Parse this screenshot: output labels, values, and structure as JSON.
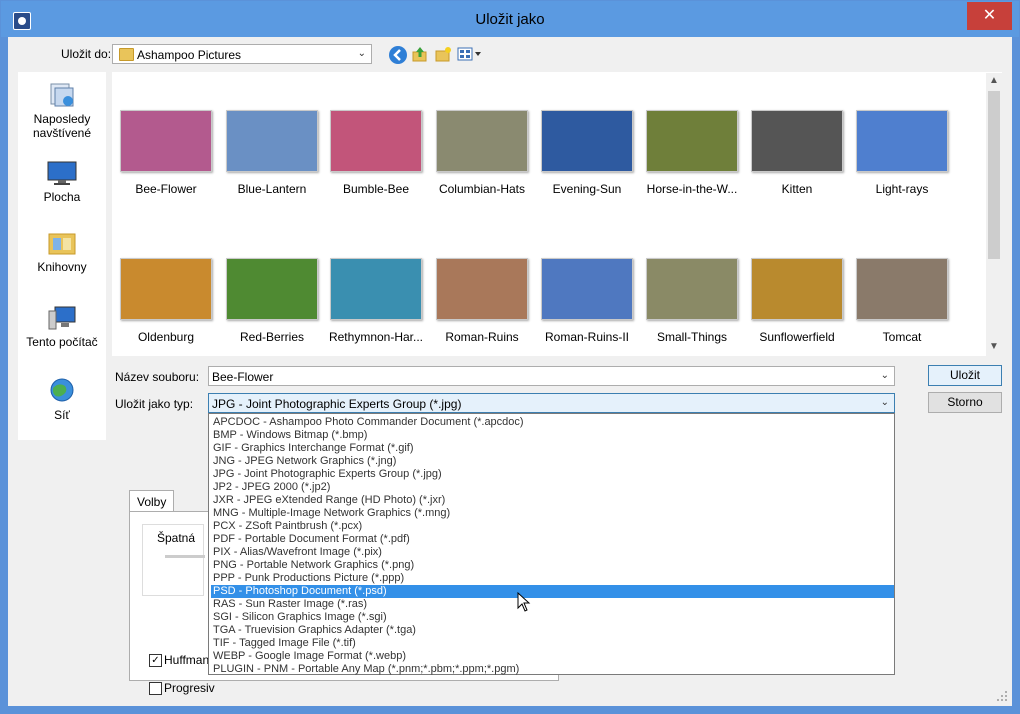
{
  "window": {
    "title": "Uložit jako",
    "close": "✕"
  },
  "save_in": {
    "label": "Uložit do:",
    "value": "Ashampoo Pictures"
  },
  "places": [
    {
      "label": "Naposledy navštívené",
      "icon": "recent-places-icon"
    },
    {
      "label": "Plocha",
      "icon": "desktop-icon"
    },
    {
      "label": "Knihovny",
      "icon": "libraries-icon"
    },
    {
      "label": "Tento počítač",
      "icon": "computer-icon"
    },
    {
      "label": "Síť",
      "icon": "network-icon"
    }
  ],
  "thumbnails": [
    {
      "name": "Bee-Flower",
      "color": "#b35a8e"
    },
    {
      "name": "Blue-Lantern",
      "color": "#6a90c4"
    },
    {
      "name": "Bumble-Bee",
      "color": "#c2557a"
    },
    {
      "name": "Columbian-Hats",
      "color": "#8a8a70"
    },
    {
      "name": "Evening-Sun",
      "color": "#2e5aa0"
    },
    {
      "name": "Horse-in-the-W...",
      "color": "#6f7f3a"
    },
    {
      "name": "Kitten",
      "color": "#555555"
    },
    {
      "name": "Light-rays",
      "color": "#4f7fcf"
    },
    {
      "name": "Oldenburg",
      "color": "#c98a2e"
    },
    {
      "name": "Red-Berries",
      "color": "#4f8a32"
    },
    {
      "name": "Rethymnon-Har...",
      "color": "#3a8fb0"
    },
    {
      "name": "Roman-Ruins",
      "color": "#a9785a"
    },
    {
      "name": "Roman-Ruins-II",
      "color": "#4f78c0"
    },
    {
      "name": "Small-Things",
      "color": "#8a8a66"
    },
    {
      "name": "Sunflowerfield",
      "color": "#b98a2e"
    },
    {
      "name": "Tomcat",
      "color": "#8a7a6a"
    }
  ],
  "filename": {
    "label": "Název souboru:",
    "value": "Bee-Flower"
  },
  "filetype": {
    "label": "Uložit jako typ:",
    "value": "JPG - Joint Photographic Experts Group (*.jpg)"
  },
  "buttons": {
    "save": "Uložit",
    "cancel": "Storno"
  },
  "filetype_options": [
    "APCDOC - Ashampoo Photo Commander Document (*.apcdoc)",
    "BMP - Windows Bitmap (*.bmp)",
    "GIF - Graphics Interchange Format (*.gif)",
    "JNG - JPEG Network Graphics (*.jng)",
    "JPG - Joint Photographic Experts Group (*.jpg)",
    "JP2 - JPEG 2000 (*.jp2)",
    "JXR - JPEG eXtended Range (HD Photo) (*.jxr)",
    "MNG - Multiple-Image Network Graphics (*.mng)",
    "PCX - ZSoft Paintbrush (*.pcx)",
    "PDF - Portable Document Format (*.pdf)",
    "PIX - Alias/Wavefront Image (*.pix)",
    "PNG - Portable Network Graphics (*.png)",
    "PPP - Punk Productions Picture (*.ppp)",
    "PSD - Photoshop Document (*.psd)",
    "RAS - Sun Raster Image (*.ras)",
    "SGI - Silicon Graphics Image (*.sgi)",
    "TGA - Truevision Graphics Adapter (*.tga)",
    "TIF - Tagged Image File (*.tif)",
    "WEBP - Google Image Format (*.webp)",
    "PLUGIN - PNM - Portable Any Map (*.pnm;*.pbm;*.ppm;*.pgm)"
  ],
  "selected_option": "PSD - Photoshop Document (*.psd)",
  "options_tab": {
    "label": "Volby",
    "quality_label": "Špatná",
    "huffman_label": "Huffmanc",
    "progressive_label": "Progresiv",
    "huffman_checked": "✓"
  }
}
